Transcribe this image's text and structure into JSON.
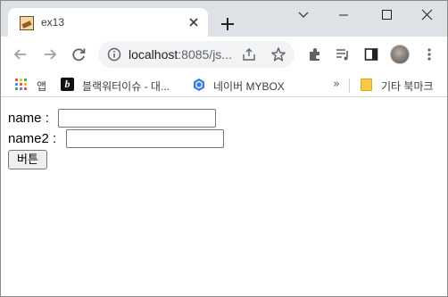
{
  "tab": {
    "title": "ex13"
  },
  "toolbar": {
    "url_host": "localhost",
    "url_rest": ":8085/js..."
  },
  "bookmarks": {
    "items": [
      {
        "label": "앱",
        "icon": "apps-grid-icon"
      },
      {
        "label": "블랙워터이슈 - 대...",
        "icon": "b-logo-icon"
      },
      {
        "label": "네이버 MYBOX",
        "icon": "mybox-icon"
      }
    ],
    "more": "»",
    "other_folder": "기타 북마크"
  },
  "form": {
    "name_label": "name :",
    "name_value": "",
    "name2_label": "name2 :",
    "name2_value": "",
    "button_label": "버튼"
  },
  "colors": {
    "titlebar": "#dee1e6",
    "omnibox": "#f1f3f4"
  }
}
